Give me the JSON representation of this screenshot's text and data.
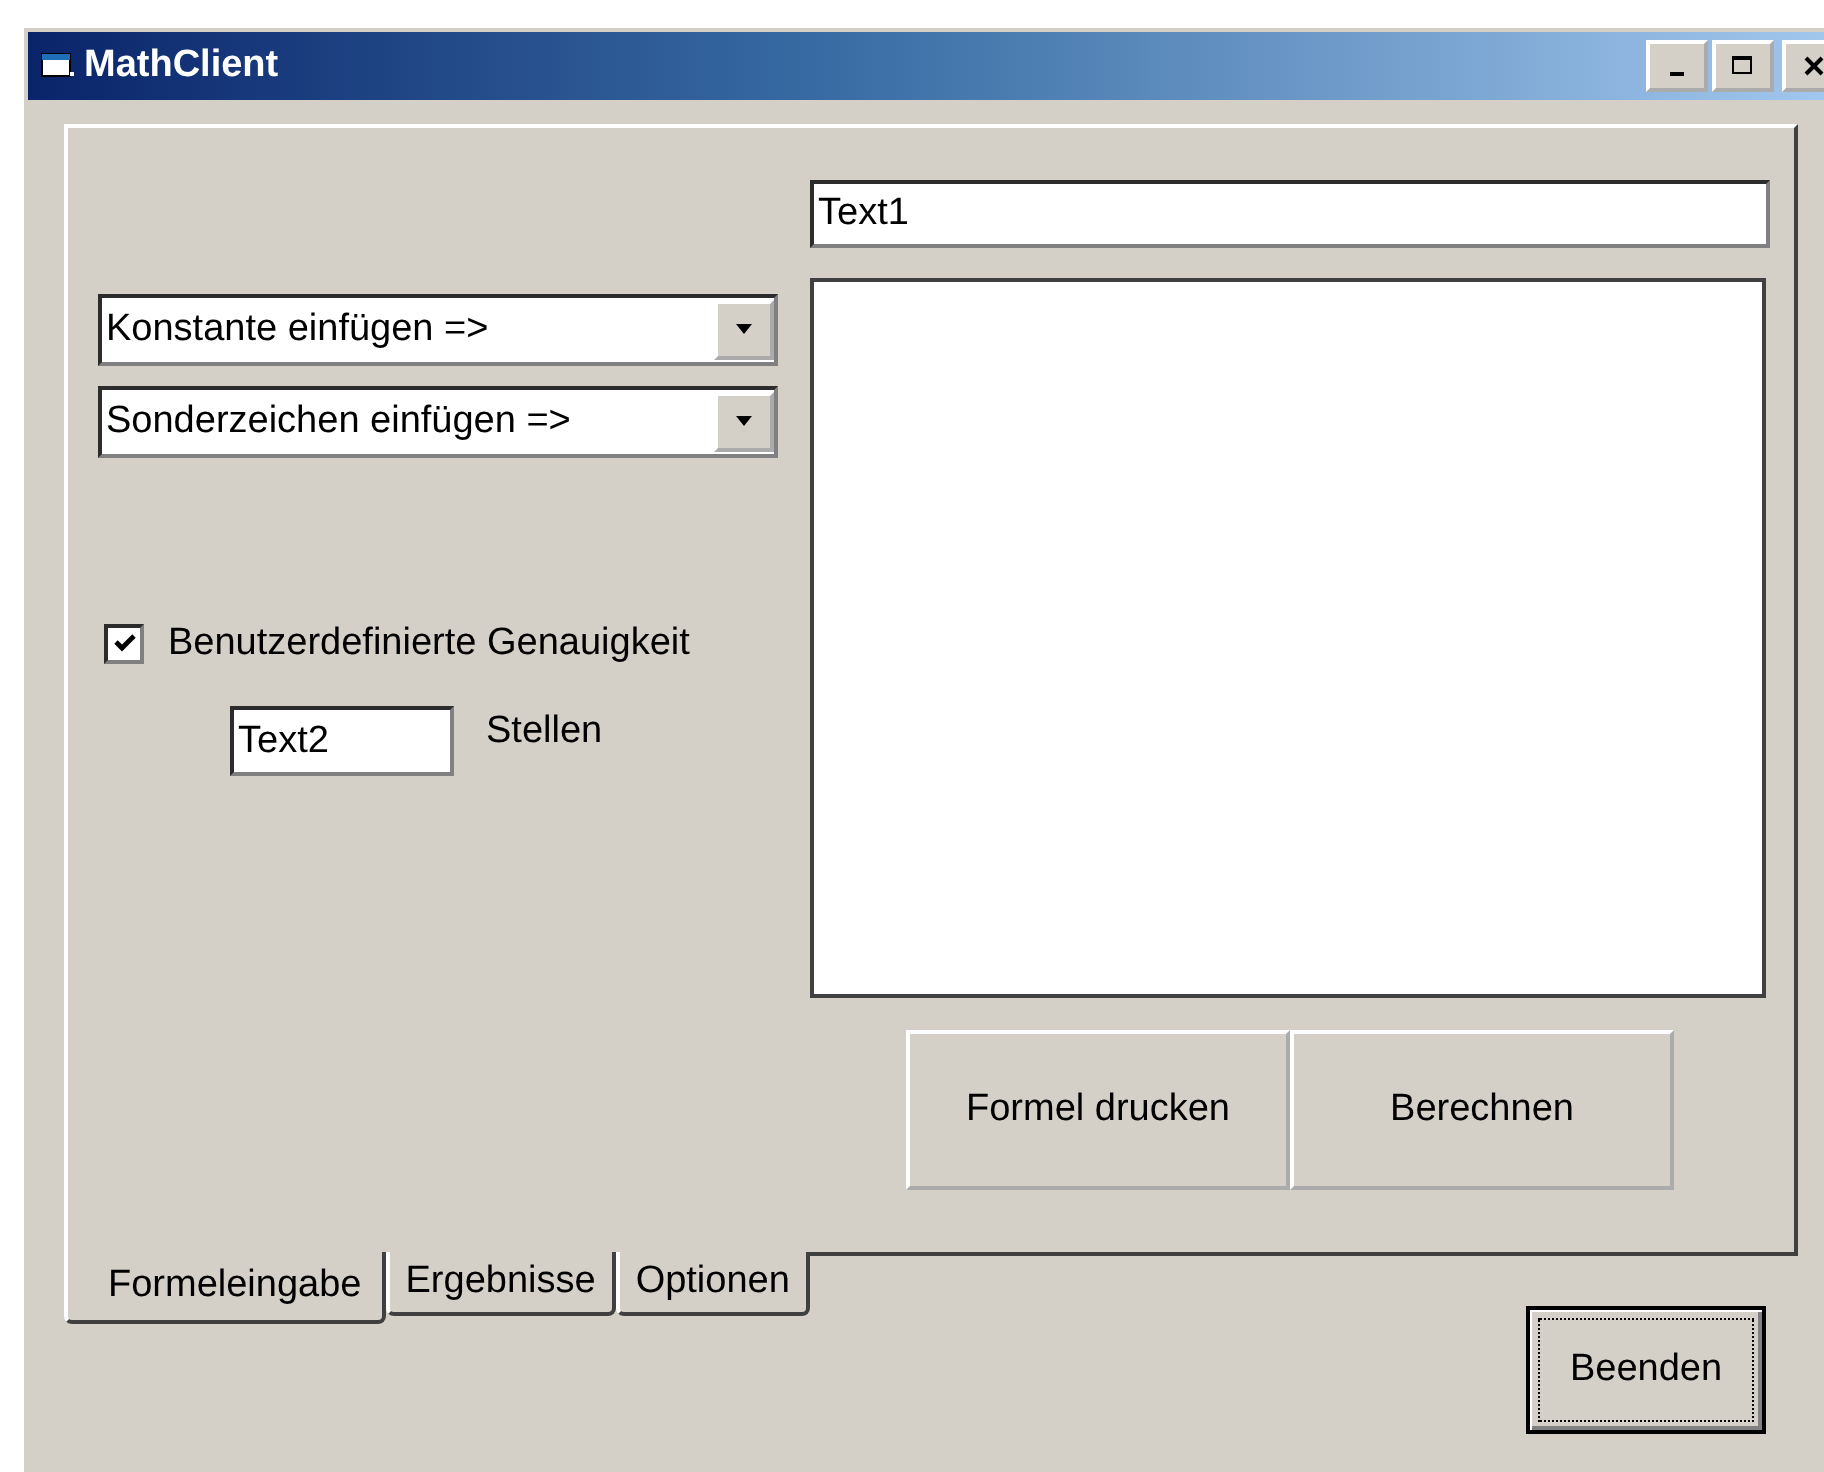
{
  "window": {
    "title": "MathClient"
  },
  "formula_field": {
    "value": "Text1"
  },
  "combos": [
    {
      "value": "Konstante einfügen =>"
    },
    {
      "value": "Sonderzeichen einfügen =>"
    }
  ],
  "precision": {
    "label": "Benutzerdefinierte Genauigkeit",
    "checked": true
  },
  "digits": {
    "value": "Text2",
    "label": "Stellen"
  },
  "buttons": [
    "Formel drucken",
    "Berechnen"
  ],
  "tabs": [
    {
      "label": "Formeleingabe",
      "selected": true
    },
    {
      "label": "Ergebnisse",
      "selected": false
    },
    {
      "label": "Optionen",
      "selected": false
    }
  ],
  "exit_button": {
    "label": "Beenden",
    "focused": true
  }
}
